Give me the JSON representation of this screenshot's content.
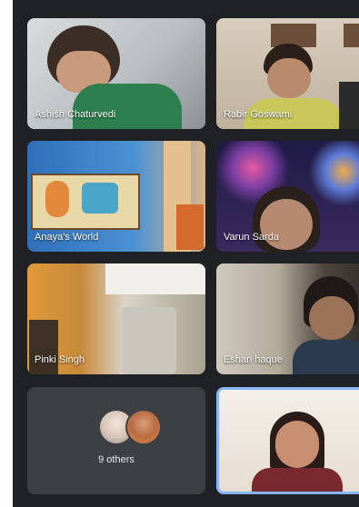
{
  "participants": [
    {
      "name": "Ashish Chaturvedi"
    },
    {
      "name": "Rabir Goswami"
    },
    {
      "name": "Anaya's World"
    },
    {
      "name": "Varun Sarda"
    },
    {
      "name": "Pinki Singh"
    },
    {
      "name": "Eshan haque"
    }
  ],
  "others": {
    "label": "9 others"
  },
  "colors": {
    "background": "#202124",
    "tile": "#3c4043",
    "active_border": "#8ab4f8"
  }
}
